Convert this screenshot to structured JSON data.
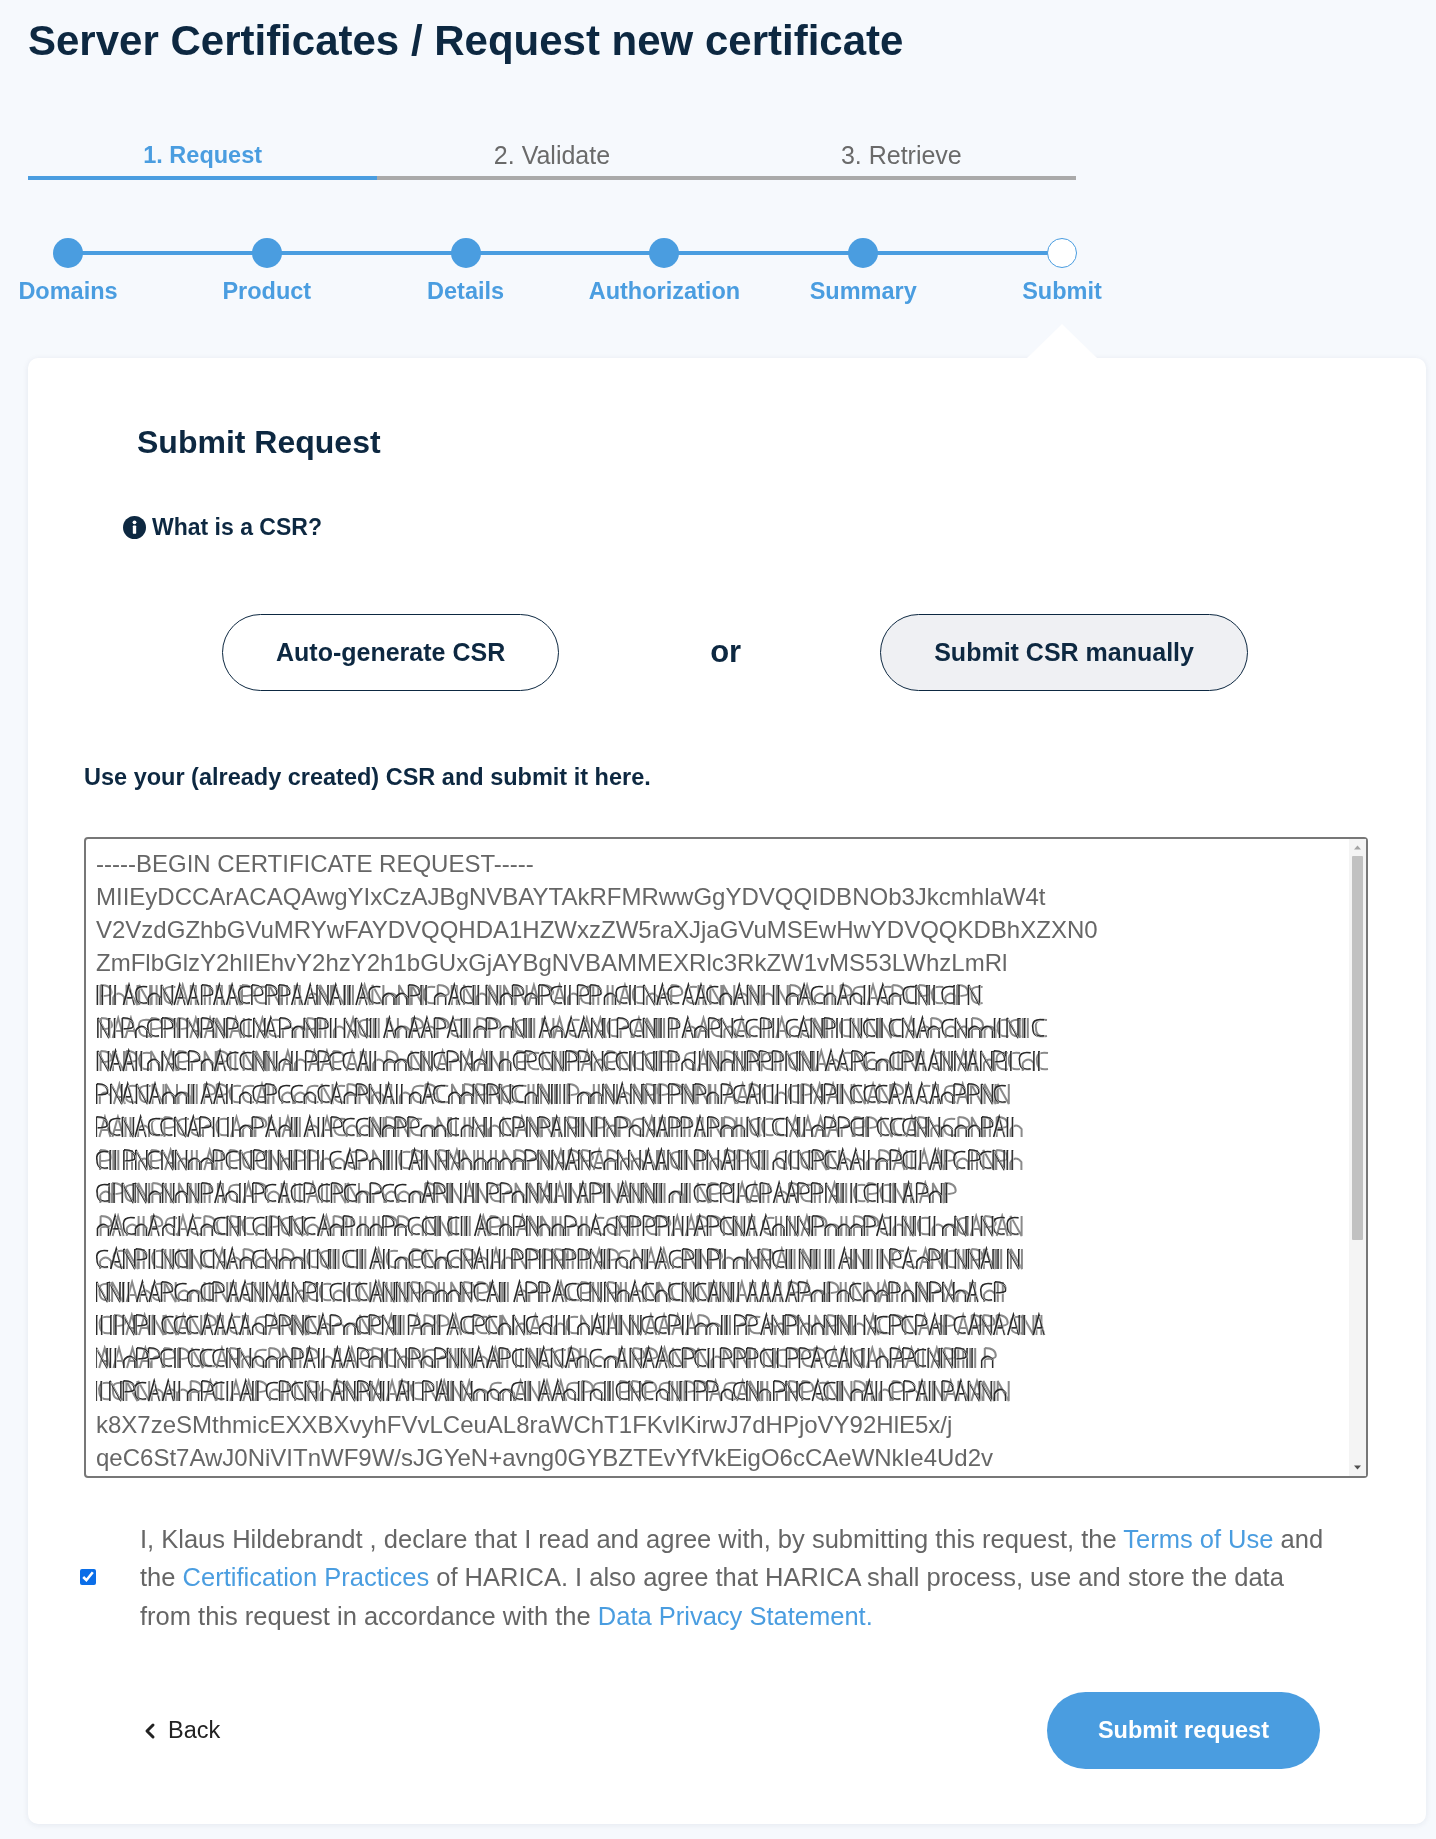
{
  "page": {
    "title": "Server Certificates / Request new certificate"
  },
  "phase_tabs": [
    {
      "label": "1. Request",
      "selected": true
    },
    {
      "label": "2. Validate",
      "selected": false
    },
    {
      "label": "3. Retrieve",
      "selected": false
    }
  ],
  "steps": [
    {
      "label": "Domains",
      "completed": true,
      "selected": false
    },
    {
      "label": "Product",
      "completed": true,
      "selected": false
    },
    {
      "label": "Details",
      "completed": true,
      "selected": false
    },
    {
      "label": "Authorization",
      "completed": true,
      "selected": false
    },
    {
      "label": "Summary",
      "completed": true,
      "selected": false
    },
    {
      "label": "Submit",
      "completed": false,
      "selected": true
    }
  ],
  "card": {
    "heading": "Submit Request",
    "info_link": "What is a CSR?",
    "csr_modes": [
      {
        "label": "Auto-generate CSR",
        "selected": false
      },
      {
        "label": "Submit CSR manually",
        "selected": true
      }
    ],
    "separator": "or",
    "instruction": "Use your (already created) CSR and submit it here.",
    "csr_field": {
      "lines": [
        {
          "kind": "text",
          "text": "-----BEGIN CERTIFICATE REQUEST-----"
        },
        {
          "kind": "text",
          "text": "MIIEyDCCArACAQAwgYIxCzAJBgNVBAYTAkRFMRwwGgYDVQQIDBNOb3JkcmhlaW4t"
        },
        {
          "kind": "text",
          "text": "V2VzdGZhbGVuMRYwFAYDVQQHDA1HZWxzZW5raXJjaGVuMSEwHwYDVQQKDBhXZXN0"
        },
        {
          "kind": "text",
          "text": "ZmFlbGlzY2hlIEhvY2hzY2h1bGUxGjAYBgNVBAMMEXRlc3RkZW1vMS53LWhzLmRl"
        },
        {
          "kind": "garbled"
        },
        {
          "kind": "garbled"
        },
        {
          "kind": "garbled"
        },
        {
          "kind": "garbled"
        },
        {
          "kind": "garbled"
        },
        {
          "kind": "garbled"
        },
        {
          "kind": "garbled"
        },
        {
          "kind": "garbled"
        },
        {
          "kind": "garbled"
        },
        {
          "kind": "garbled"
        },
        {
          "kind": "garbled"
        },
        {
          "kind": "garbled"
        },
        {
          "kind": "garbled"
        },
        {
          "kind": "text",
          "text": "k8X7zeSMthmicEXXBXvyhFVvLCeuAL8raWChT1FKvlKirwJ7dHPjoVY92HlE5x/j"
        },
        {
          "kind": "text",
          "text": "qeC6St7AwJ0NiVITnWF9W/sJGYeN+avng0GYBZTEvYfVkEigO6cCAeWNkIe4Ud2v"
        }
      ]
    },
    "consent": {
      "checked": true,
      "parts": [
        {
          "kind": "text",
          "text": "I, Klaus Hildebrandt , declare that I read and agree with, by submitting this request, the "
        },
        {
          "kind": "link",
          "text": "Terms of Use"
        },
        {
          "kind": "text",
          "text": " and the "
        },
        {
          "kind": "link",
          "text": "Certification Practices"
        },
        {
          "kind": "text",
          "text": " of HARICA. I also agree that HARICA shall process, use and store the data from this request in accordance with the "
        },
        {
          "kind": "link",
          "text": "Data Privacy Statement."
        }
      ]
    },
    "back_button": "Back",
    "submit_button": "Submit request"
  }
}
